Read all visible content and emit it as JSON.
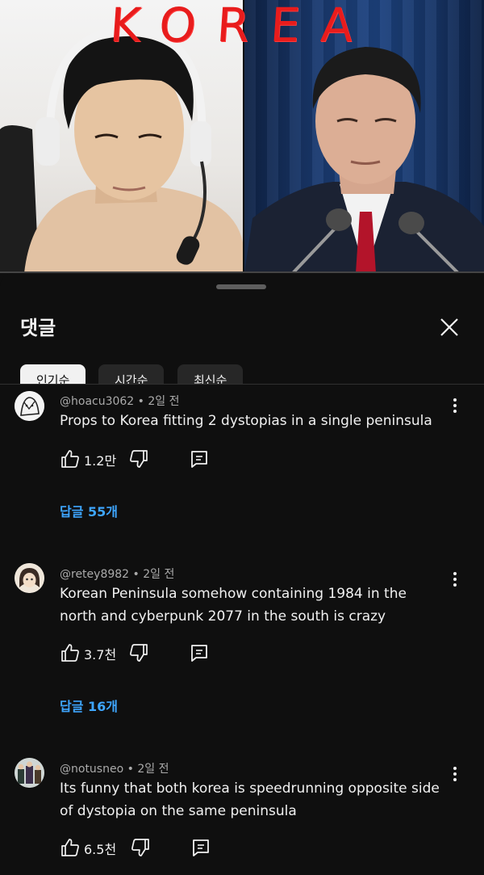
{
  "video": {
    "overlay_text": "KOREA",
    "colors": {
      "overlay": "#e81c1c",
      "curtain": "#1d4380"
    }
  },
  "sheet": {
    "title": "댓글",
    "close_icon": "close-icon",
    "sort_chips": [
      {
        "label": "인기순",
        "selected": true
      },
      {
        "label": "시간순",
        "selected": false
      },
      {
        "label": "최신순",
        "selected": false
      }
    ]
  },
  "comments": [
    {
      "author": "@hoacu3062",
      "time": "2일 전",
      "text": "Props to Korea fitting 2 dystopias in a single peninsula",
      "likes": "1.2만",
      "replies_label": "답글 55개"
    },
    {
      "author": "@retey8982",
      "time": "2일 전",
      "text": "Korean Peninsula somehow containing 1984 in the north and cyberpunk 2077 in the south is crazy",
      "likes": "3.7천",
      "replies_label": "답글 16개"
    },
    {
      "author": "@notusneo",
      "time": "2일 전",
      "text": "Its funny that both korea is speedrunning opposite side of dystopia on the same peninsula",
      "likes": "6.5천"
    }
  ],
  "colors": {
    "background": "#0f0f0f",
    "link": "#3ea6ff",
    "secondary_text": "#aaaaaa"
  }
}
